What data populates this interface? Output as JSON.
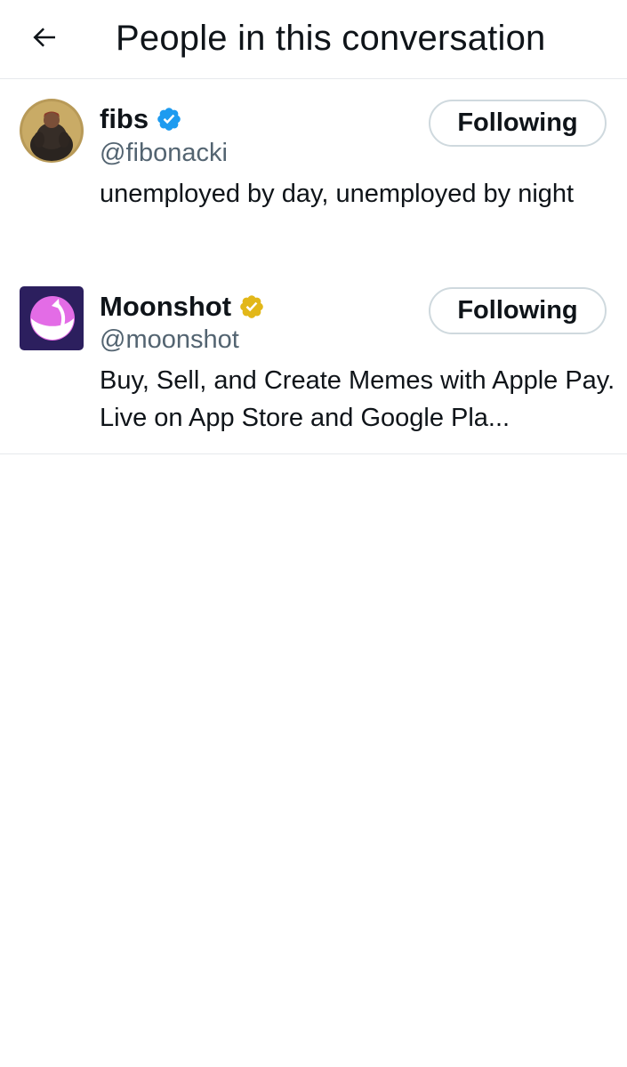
{
  "header": {
    "title": "People in this conversation"
  },
  "users": [
    {
      "display_name": "fibs",
      "handle": "@fibonacki",
      "bio": "unemployed by day, unemployed by night",
      "verified_badge": "blue-verified-icon",
      "badge_color": "#1d9bf0",
      "follow_label": "Following"
    },
    {
      "display_name": "Moonshot",
      "handle": "@moonshot",
      "bio": "Buy, Sell, and Create Memes with Apple Pay. Live on App Store and Google Pla...",
      "verified_badge": "gold-verified-icon",
      "badge_color": "#e2b719",
      "follow_label": "Following"
    }
  ]
}
